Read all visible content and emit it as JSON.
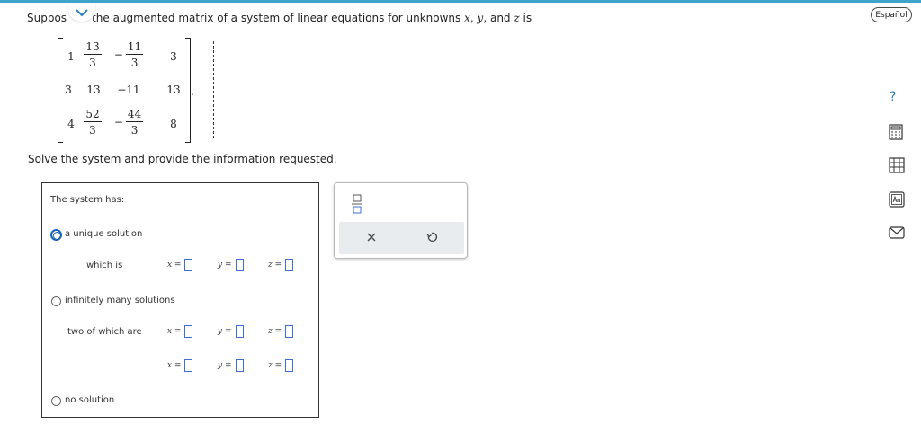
{
  "problem": {
    "prompt_start": "Suppos",
    "prompt_middle": "the augmented matrix of a system of linear equations for unknowns",
    "var_x": "x",
    "var_y": "y",
    "var_z": "z",
    "and_text": "and",
    "is_text": "is",
    "comma": ",",
    "matrix_rows": [
      [
        "1",
        "13/3",
        "-11/3",
        "3"
      ],
      [
        "3",
        "13",
        "-11",
        "13"
      ],
      [
        "4",
        "52/3",
        "-44/3",
        "8"
      ]
    ],
    "m": {
      "r1c1": "1",
      "r1c2_num": "13",
      "r1c2_den": "3",
      "r1c3_sign": "−",
      "r1c3_num": "11",
      "r1c3_den": "3",
      "r1c4": "3",
      "r2c1": "3",
      "r2c2": "13",
      "r2c3": "−11",
      "r2c4": "13",
      "r3c1": "4",
      "r3c2_num": "52",
      "r3c2_den": "3",
      "r3c3_sign": "−",
      "r3c3_num": "44",
      "r3c3_den": "3",
      "r3c4": "8"
    },
    "period": ".",
    "instruction": "Solve the system and provide the information requested."
  },
  "answer": {
    "heading": "The system has:",
    "options": [
      {
        "label": "a unique solution",
        "selected": true
      },
      {
        "label": "infinitely many solutions",
        "selected": false
      },
      {
        "label": "no solution",
        "selected": false
      }
    ],
    "unique_label": "which is",
    "infinite_label": "two of which are",
    "eq_x": "x =",
    "eq_y": "y =",
    "eq_z": "z =",
    "unique_inputs": {
      "x": "",
      "y": "",
      "z": ""
    },
    "infinite_inputs_1": {
      "x": "",
      "y": "",
      "z": ""
    },
    "infinite_inputs_2": {
      "x": "",
      "y": "",
      "z": ""
    }
  },
  "toolbar": {
    "language_label": "Español",
    "icons": [
      "fraction-icon",
      "clear-icon",
      "undo-icon",
      "help-icon",
      "calculator-icon",
      "data-icon",
      "textbook-icon",
      "message-icon"
    ],
    "help_glyph": "?",
    "clear_glyph": "×"
  },
  "colors": {
    "accent": "#3fa3cc",
    "radio_selected": "#1b63b5",
    "input_border": "#3b6fd1",
    "action_bg": "#e9ecef"
  }
}
